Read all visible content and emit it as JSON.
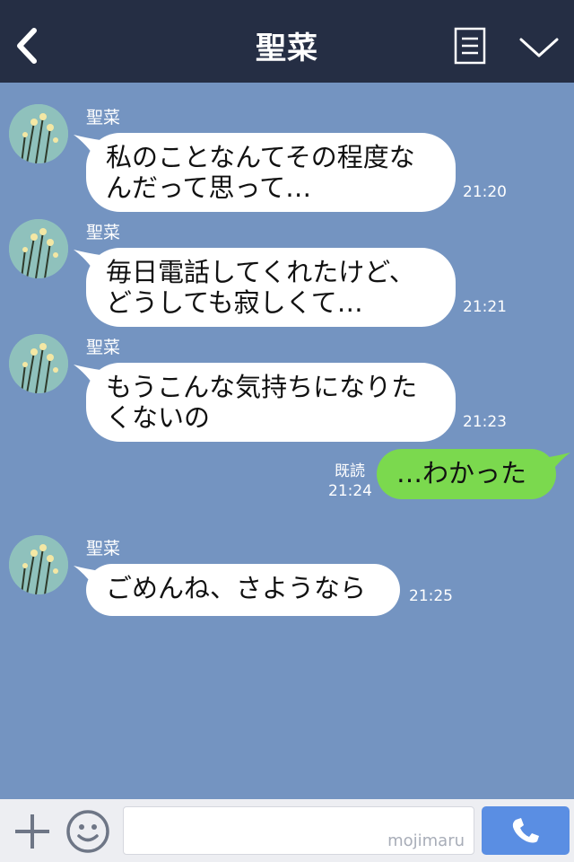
{
  "header": {
    "title": "聖菜"
  },
  "messages": [
    {
      "sender": "聖菜",
      "text": "私のことなんてその程度な\nんだって思って…",
      "time": "21:20"
    },
    {
      "sender": "聖菜",
      "text": "毎日電話してくれたけど、\nどうしても寂しくて…",
      "time": "21:21"
    },
    {
      "sender": "聖菜",
      "text": "もうこんな気持ちになりた\nくないの",
      "time": "21:23"
    },
    {
      "sender": "聖菜",
      "text": "ごめんね、さようなら",
      "time": "21:25"
    }
  ],
  "my_message": {
    "text": "…わかった",
    "read_label": "既読",
    "time": "21:24"
  },
  "footer": {
    "watermark": "mojimaru"
  },
  "colors": {
    "header": "#252e44",
    "chat_bg": "#7494c1",
    "my_bubble": "#7bd94e",
    "call_button": "#5a8ee3"
  }
}
